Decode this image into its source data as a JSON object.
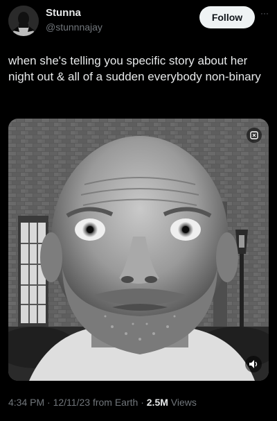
{
  "author": {
    "display_name": "Stunna",
    "handle": "@stunnnajay",
    "avatar_icon": "profile-photo-avatar"
  },
  "actions": {
    "follow_label": "Follow",
    "more_label": "···"
  },
  "tweet": {
    "text": "when she's telling you specific story about her night out & all of a sudden everybody non-binary"
  },
  "media": {
    "type": "video",
    "badge_icon": "gif-sticker-icon",
    "mute_icon": "speaker-muted-icon"
  },
  "meta": {
    "time": "4:34 PM",
    "sep1": " · ",
    "date": "12/11/23",
    "source": " from Earth",
    "sep2": " · ",
    "views_count": "2.5M",
    "views_label": " Views"
  },
  "colors": {
    "background": "#000000",
    "text_primary": "#e7e9ea",
    "text_secondary": "#71767b",
    "follow_button_bg": "#eff3f4",
    "follow_button_text": "#0f1419"
  }
}
